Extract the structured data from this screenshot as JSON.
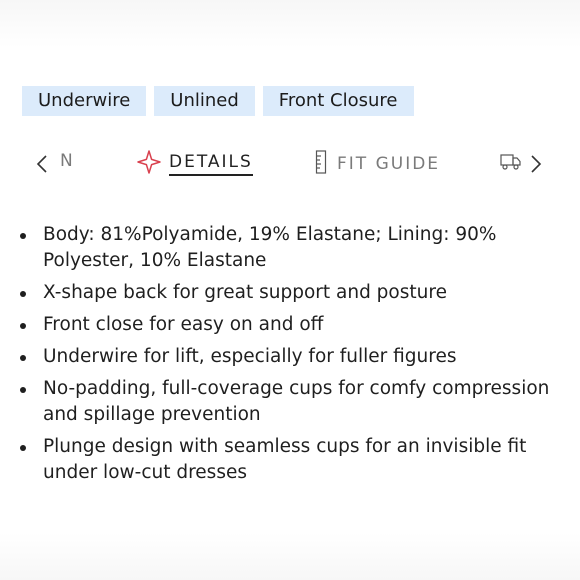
{
  "tags": [
    "Underwire",
    "Unlined",
    "Front Closure"
  ],
  "tabs": {
    "prev_partial_label": "N",
    "details_label": "DETAILS",
    "fit_guide_label": "FIT GUIDE"
  },
  "icons": {
    "details": "sparkle-star-icon",
    "fit_guide": "ruler-icon",
    "next_tab": "truck-icon",
    "prev": "chevron-left-icon",
    "next": "chevron-right-icon"
  },
  "colors": {
    "tag_background": "#dcebfb",
    "details_icon": "#d9414f",
    "text": "#1f1f1f",
    "muted_tab": "#7a7a7a"
  },
  "details": [
    "Body: 81%Polyamide, 19% Elastane; Lining: 90% Polyester, 10% Elastane",
    "X-shape back for great support and posture",
    "Front close for easy on and off",
    "Underwire for lift, especially for fuller figures",
    "No-padding, full-coverage cups for comfy compression and spillage prevention",
    "Plunge design with seamless cups for an invisible fit under low-cut dresses"
  ]
}
